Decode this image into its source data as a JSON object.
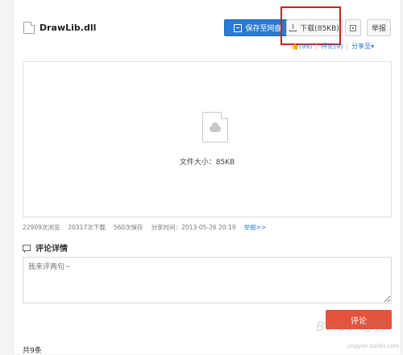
{
  "file": {
    "name": "DrawLib.dll"
  },
  "toolbar": {
    "save_label": "保存至网盘",
    "download_label": "下载(85KB)",
    "report_label": "举报"
  },
  "social": {
    "likes": "(99)",
    "comments": "评论(9)",
    "share": "分享至▾"
  },
  "preview": {
    "size_label": "文件大小：85KB"
  },
  "stats": {
    "views": "22909次浏览",
    "downloads": "20317次下载",
    "saves": "560次保存",
    "share_time": "分享时间：2013-05-26 20:19",
    "report_link": "举报>>"
  },
  "comments_section": {
    "title": "评论详情",
    "placeholder": "我来评两句~",
    "submit_label": "评论",
    "count": "共9条"
  },
  "watermark": {
    "text": "Baidu 经验",
    "sub": "jingyan.baidu.com"
  },
  "colors": {
    "primary": "#2a7ad6",
    "highlight": "#d21e1e",
    "submit": "#e5533b"
  }
}
